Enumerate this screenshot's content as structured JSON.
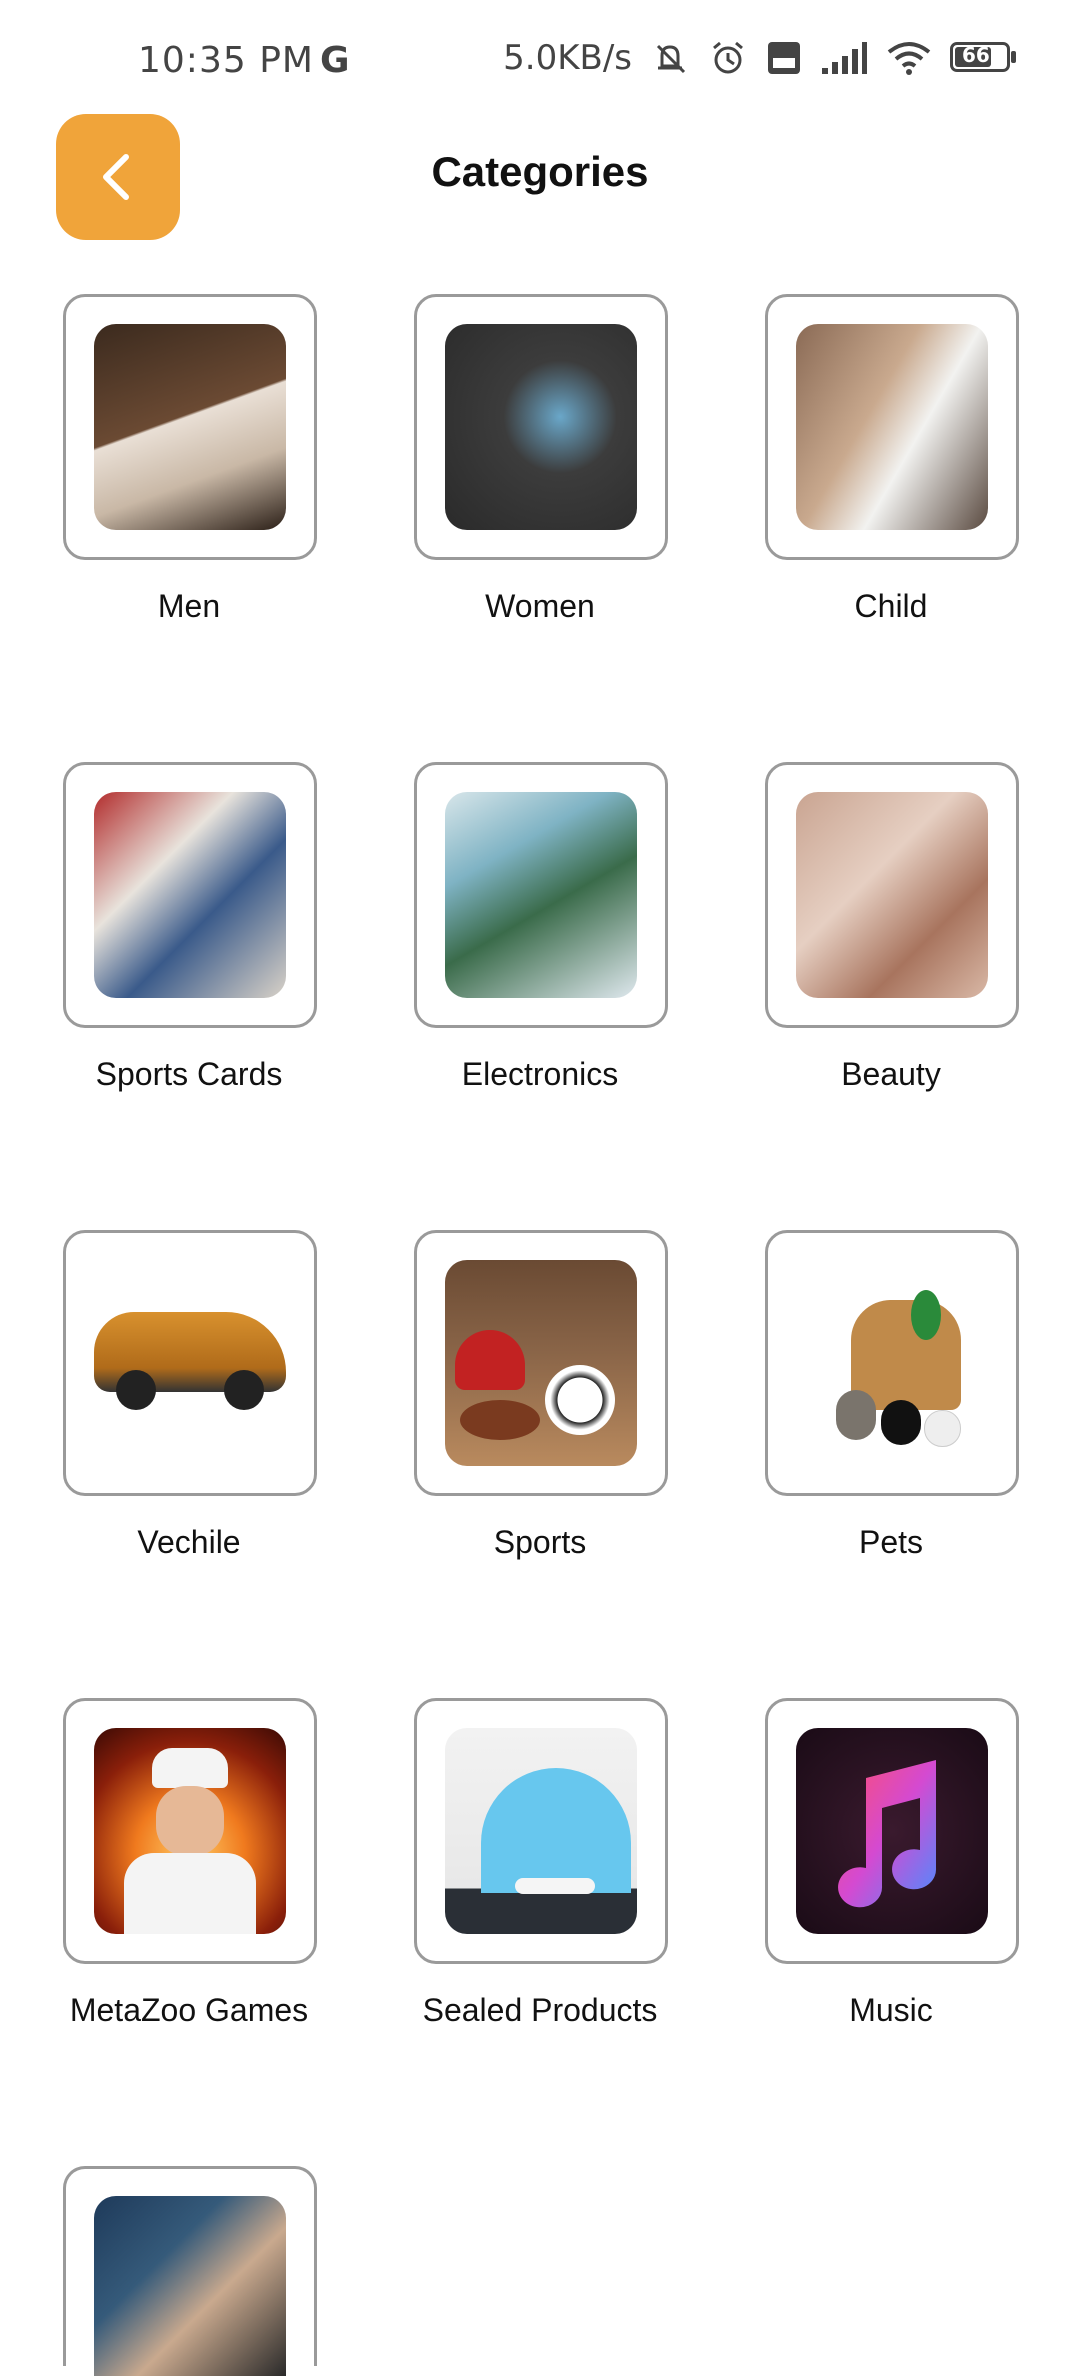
{
  "status_bar": {
    "time": "10:35 PM",
    "carrier_glyph": "G",
    "network_speed": "5.0KB/s",
    "battery": "66",
    "icons": [
      "mute-bell-icon",
      "alarm-icon",
      "volte-icon",
      "signal-icon",
      "wifi-icon",
      "battery-icon"
    ]
  },
  "header": {
    "title": "Categories",
    "back_icon": "chevron-left-icon",
    "accent": "#f0a43a"
  },
  "categories": [
    {
      "label": "Men"
    },
    {
      "label": "Women"
    },
    {
      "label": "Child"
    },
    {
      "label": "Sports Cards"
    },
    {
      "label": "Electronics"
    },
    {
      "label": "Beauty"
    },
    {
      "label": "Vechile"
    },
    {
      "label": "Sports"
    },
    {
      "label": "Pets"
    },
    {
      "label": "MetaZoo Games"
    },
    {
      "label": "Sealed Products"
    },
    {
      "label": "Music"
    },
    {
      "label": ""
    }
  ]
}
